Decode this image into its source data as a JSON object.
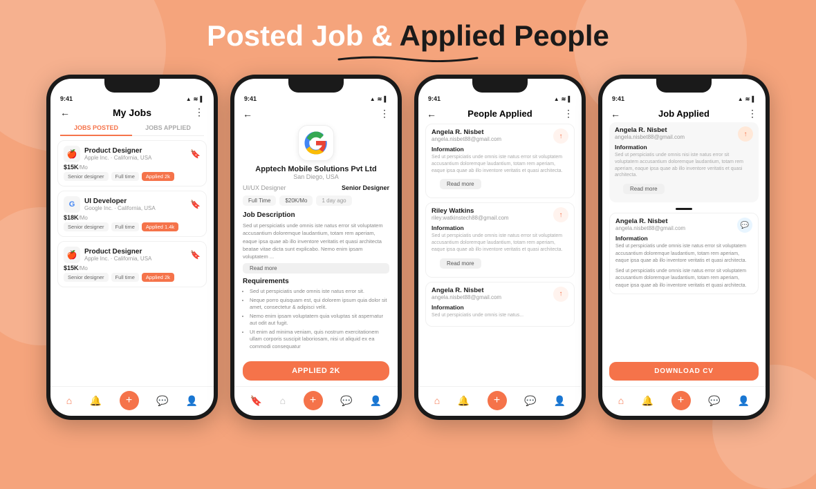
{
  "page": {
    "title_part1": "Posted Job & ",
    "title_part2": "Applied People",
    "bg_color": "#F5A47C"
  },
  "phone1": {
    "status_time": "9:41",
    "header_title": "My Jobs",
    "tab1": "JOBS POSTED",
    "tab2": "JOBS APPLIED",
    "jobs": [
      {
        "title": "Product Designer",
        "company": "Apple Inc.",
        "location": "California, USA",
        "salary": "$15K",
        "salary_suffix": "/Mo",
        "tags": [
          "Senior designer",
          "Full time"
        ],
        "applied": "Applied 2k",
        "logo": "🍎"
      },
      {
        "title": "UI Developer",
        "company": "Google Inc.",
        "location": "California, USA",
        "salary": "$18K",
        "salary_suffix": "/Mo",
        "tags": [
          "Senior designer",
          "Full time"
        ],
        "applied": "Applied 1.4k",
        "logo": "G"
      },
      {
        "title": "Product Designer",
        "company": "Apple Inc.",
        "location": "California, USA",
        "salary": "$15K",
        "salary_suffix": "/Mo",
        "tags": [
          "Senior designer",
          "Full time"
        ],
        "applied": "Applied 2k",
        "logo": "🍎"
      }
    ]
  },
  "phone2": {
    "status_time": "9:41",
    "company_name": "Apptech Mobile Solutions Pvt Ltd",
    "company_location": "San Diego, USA",
    "role_label": "UI/UX Designer",
    "role_value": "Senior Designer",
    "tags": [
      "Full Time",
      "$20K/Mo",
      "1 day ago"
    ],
    "section_job_desc": "Job Description",
    "job_desc_text": "Sed ut perspiciatis unde omnis iste natus error sit voluptatem accusantium doloremque laudantium, totam rem aperiam, eaque ipsa quae ab illo inventore veritatis et quasi architecta beatae vitae dicta sunt explicabo. Nemo enim ipsam voluptatem ...",
    "read_more": "Read more",
    "section_requirements": "Requirements",
    "req1": "Sed ut perspiciatis unde omnis iste natus error sit.",
    "req2": "Neque porro quisquam est, qui dolorem ipsum quia dolor sit amet, consectetur & adipisci velit.",
    "req3": "Nemo enim ipsam voluptatem quia voluptas sit aspernatur aut odit aut fugit.",
    "req4": "Ut enim ad minima veniam, quis nostrum exercitationem ullam corporis suscipit laboriosam, nisi ut aliquid ex ea commodi consequatur",
    "apply_btn": "APPLIED 2K"
  },
  "phone3": {
    "status_time": "9:41",
    "header_title": "People Applied",
    "applicants": [
      {
        "name": "Angela R. Nisbet",
        "email": "angela.nisbet88@gmail.com",
        "info_label": "Information",
        "info_text": "Sed ut perspiciatis unde omnis iste natus error sit voluptatem accusantium doloremque laudantium, totam rem aperiam, eaque ipsa quae ab illo inventore veritatis et quasi architecta.",
        "read_more": "Read more"
      },
      {
        "name": "Riley Watkins",
        "email": "riley.watkinstech88@gmail.com",
        "info_label": "Information",
        "info_text": "Sed ut perspiciatis unde omnis iste natus error sit voluptatem accusantium doloremque laudantium, totam rem aperiam, eaque ipsa quae ab illo inventore veritatis et quasi architecta.",
        "read_more": "Read more"
      },
      {
        "name": "Angela R. Nisbet",
        "email": "angela.nisbet88@gmail.com",
        "info_label": "Information",
        "info_text": "Sed ut perspiciatis unde omnis iste natus..."
      }
    ]
  },
  "phone4": {
    "status_time": "9:41",
    "header_title": "Job Applied",
    "selected_applicant": {
      "name": "Angela R. Nisbet",
      "email": "angela.nisbet88@gmail.com"
    },
    "info_label": "Information",
    "info_text1": "Sed ut perspiciatis unde omnis nisi iste natus error sit voluptatem accusantium doloremque laudantium, totam rem aperiam, eaque ipsa quae ab illo inventore veritatis et quasi architecta.",
    "chat_section_name": "Angela R. Nisbet",
    "chat_section_email": "angela.nisbet88@gmail.com",
    "chat_info_label": "Information",
    "chat_text1": "Sed ut perspiciatis unde omnis iste natus error sit voluptatem accusantium doloremque laudantium, totam rem aperiam, eaque ipsa quae ab illo inventore veritatis et quasi architecta.",
    "chat_text2": "Sed ut perspiciatis unde omnis iste natus error sit voluptatem accusantium doloremque laudantium, totam rem aperiam, eaque ipsa quae ab illo inventore veritatis et quasi architecta.",
    "download_btn": "DOWNLOAD CV"
  },
  "icons": {
    "back_arrow": "←",
    "bookmark": "🔖",
    "more_dots": "⋮",
    "home": "⌂",
    "bell": "🔔",
    "plus": "+",
    "chat": "💬",
    "person": "👤",
    "upload": "↑",
    "signal": "▲",
    "wifi": "WiFi",
    "battery": "▌"
  }
}
